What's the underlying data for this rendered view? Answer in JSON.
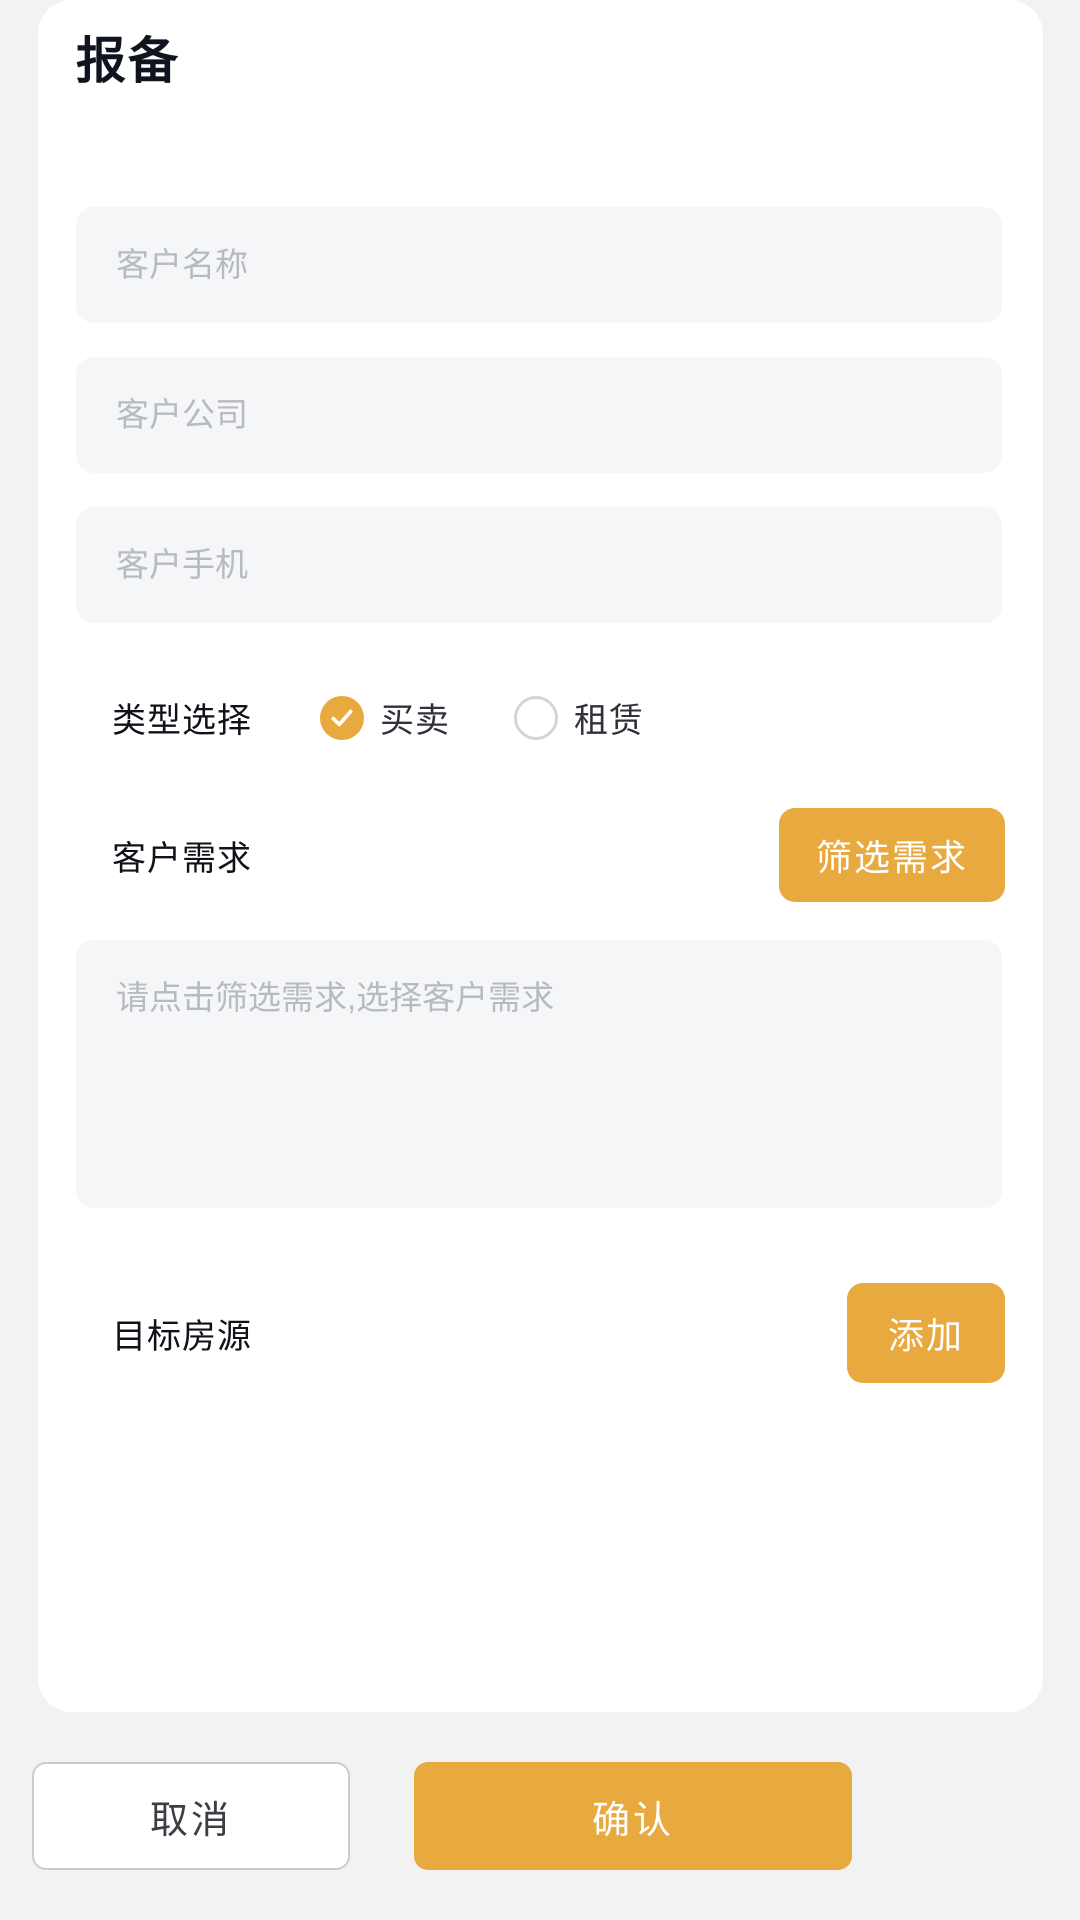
{
  "page": {
    "title": "报备"
  },
  "form": {
    "customer_name": {
      "placeholder": "客户名称",
      "value": ""
    },
    "customer_company": {
      "placeholder": "客户公司",
      "value": ""
    },
    "customer_phone": {
      "placeholder": "客户手机",
      "value": ""
    },
    "type_selection": {
      "label": "类型选择",
      "selected": "买卖",
      "options": [
        {
          "label": "买卖",
          "checked": true
        },
        {
          "label": "租赁",
          "checked": false
        }
      ]
    },
    "customer_requirement": {
      "label": "客户需求",
      "filter_button": "筛选需求",
      "textarea_placeholder": "请点击筛选需求,选择客户需求",
      "textarea_value": ""
    },
    "target_property": {
      "label": "目标房源",
      "add_button": "添加"
    }
  },
  "footer": {
    "cancel_label": "取消",
    "confirm_label": "确认"
  },
  "colors": {
    "accent": "#e8a93e",
    "field_bg": "#f5f6f7",
    "page_bg": "#f2f2f3",
    "sheet_bg": "#ffffff",
    "placeholder": "#b7babf",
    "title": "#10141f"
  },
  "icons": {
    "check": "check-icon",
    "radio_empty": "radio-unchecked-icon"
  }
}
